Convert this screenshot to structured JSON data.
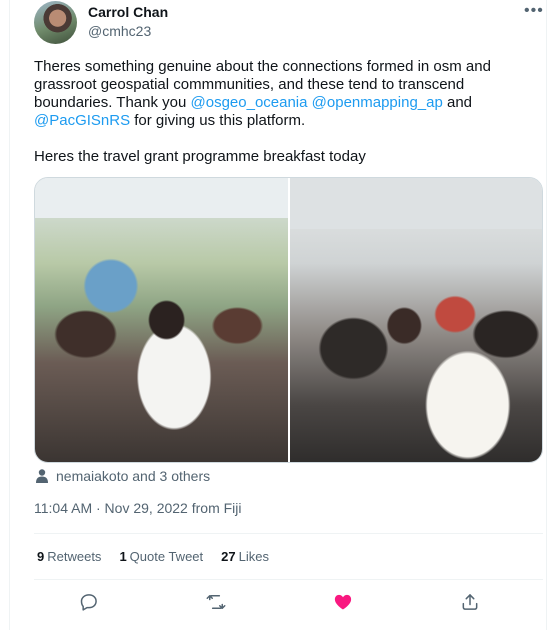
{
  "author": {
    "display_name": "Carrol Chan",
    "handle": "@cmhc23"
  },
  "tweet": {
    "line1_text": "Theres something genuine about the connections formed in osm and grassroot geospatial commmunities, and these tend to transcend boundaries. Thank you ",
    "mention1": "@osgeo_oceania",
    "space": " ",
    "mention2": "@openmapping_ap",
    "and_text": " and",
    "mention3": "@PacGISnRS",
    "tail_text": " for giving us this platform.",
    "line2_text": "Heres the travel grant programme breakfast today"
  },
  "media": {
    "photos": [
      "photo-1",
      "photo-2"
    ]
  },
  "tagged": {
    "icon": "person-icon",
    "text": "nemaiakoto and 3 others"
  },
  "meta": {
    "timestamp": "11:04 AM · Nov 29, 2022 from Fiji"
  },
  "stats": {
    "retweets_count": "9",
    "retweets_label": "Retweets",
    "quotes_count": "1",
    "quotes_label": "Quote Tweet",
    "likes_count": "27",
    "likes_label": "Likes"
  },
  "actions": {
    "reply_icon": "reply-icon",
    "retweet_icon": "retweet-icon",
    "like_icon": "heart-icon",
    "share_icon": "share-icon"
  },
  "colors": {
    "link": "#1d9bf0",
    "like": "#f91880",
    "muted": "#536471",
    "text": "#0f1419"
  }
}
